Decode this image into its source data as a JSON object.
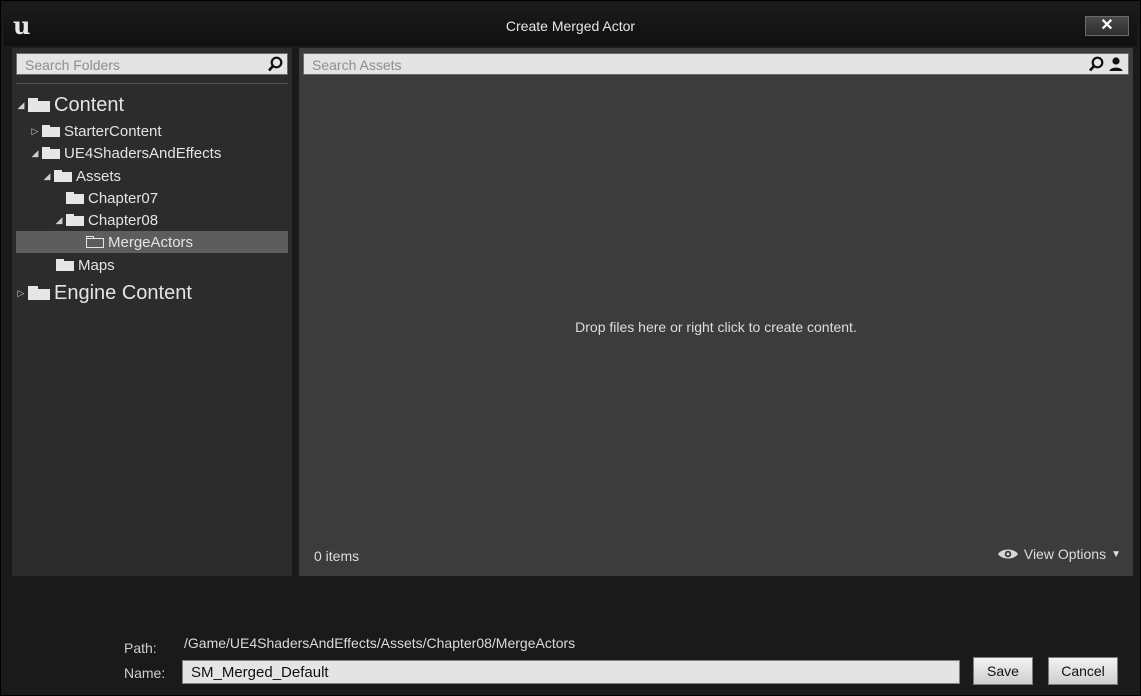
{
  "window": {
    "title": "Create Merged Actor",
    "close_label": "✕",
    "logo": "u"
  },
  "left": {
    "search_placeholder": "Search Folders",
    "tree": [
      {
        "label": "Content"
      },
      {
        "label": "StarterContent"
      },
      {
        "label": "UE4ShadersAndEffects"
      },
      {
        "label": "Assets"
      },
      {
        "label": "Chapter07"
      },
      {
        "label": "Chapter08"
      },
      {
        "label": "MergeActors"
      },
      {
        "label": "Maps"
      },
      {
        "label": "Engine Content"
      }
    ]
  },
  "right": {
    "search_placeholder": "Search Assets",
    "drop_message": "Drop files here or right click to create content.",
    "items_count": "0 items",
    "view_options": "View Options"
  },
  "footer": {
    "path_label": "Path:",
    "path_value": "/Game/UE4ShadersAndEffects/Assets/Chapter08/MergeActors",
    "name_label": "Name:",
    "name_value": "SM_Merged_Default",
    "save_label": "Save",
    "cancel_label": "Cancel"
  }
}
